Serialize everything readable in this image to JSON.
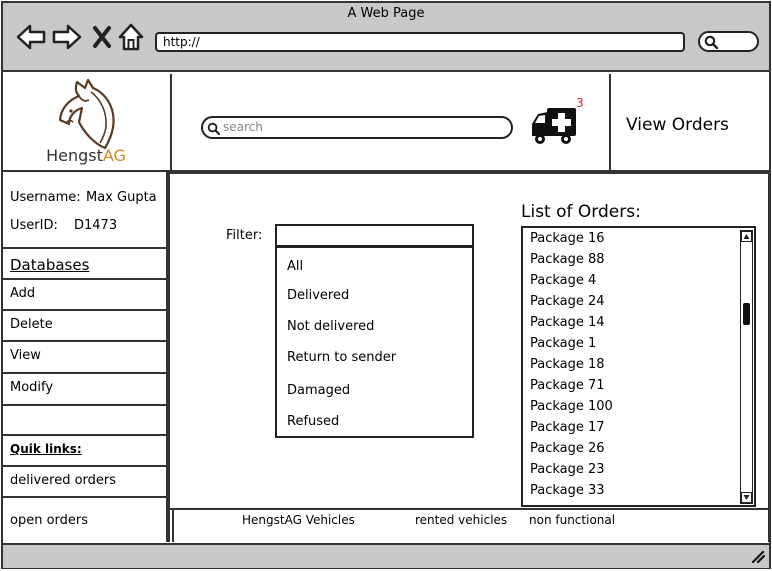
{
  "browser": {
    "window_title": "A Web Page",
    "url_value": "http://",
    "back_icon": "back-arrow-icon",
    "forward_icon": "forward-arrow-icon",
    "close_icon": "close-icon",
    "home_icon": "home-icon",
    "search_icon": "search-icon"
  },
  "header": {
    "brand_prefix": "Hengst",
    "brand_suffix": "AG",
    "search_placeholder": "search",
    "notification_count": "3",
    "view_orders_label": "View Orders",
    "accent_color": "#d08a1a",
    "badge_color": "#d62020"
  },
  "user": {
    "username_label": "Username:",
    "username_value": "Max Gupta",
    "userid_label": "UserID:",
    "userid_value": "D1473"
  },
  "sidebar": {
    "section_title": "Databases",
    "items": [
      "Add",
      "Delete",
      "View",
      "Modify"
    ],
    "quick_links_title": "Quik links:",
    "quick_links": [
      "delivered orders",
      "open orders"
    ]
  },
  "filter": {
    "label": "Filter:",
    "value": "",
    "options": [
      "All",
      "Delivered",
      "Not delivered",
      "Return to sender",
      "Damaged",
      "Refused"
    ]
  },
  "orders": {
    "title": "List of Orders:",
    "items": [
      "Package 16",
      "Package 88",
      "Package 4",
      "Package 24",
      "Package 14",
      "Package 1",
      "Package 18",
      "Package 71",
      "Package 100",
      "Package 17",
      "Package 26",
      "Package 23",
      "Package 33"
    ]
  },
  "footer": {
    "links": [
      "HengstAG Vehicles",
      "rented vehicles",
      "non functional"
    ]
  }
}
